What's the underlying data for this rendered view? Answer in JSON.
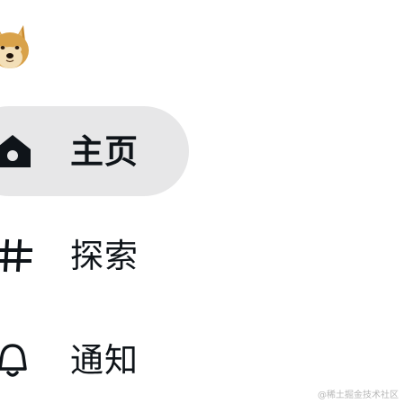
{
  "sidebar": {
    "items": [
      {
        "label": "主页",
        "icon": "home-icon",
        "active": true
      },
      {
        "label": "探索",
        "icon": "hashtag-icon",
        "active": false
      },
      {
        "label": "通知",
        "icon": "bell-icon",
        "active": false
      }
    ]
  },
  "watermark": "@稀土掘金技术社区",
  "colors": {
    "text": "#0f1419",
    "active_bg": "#e7e7e8",
    "watermark": "#b8b8b8"
  }
}
